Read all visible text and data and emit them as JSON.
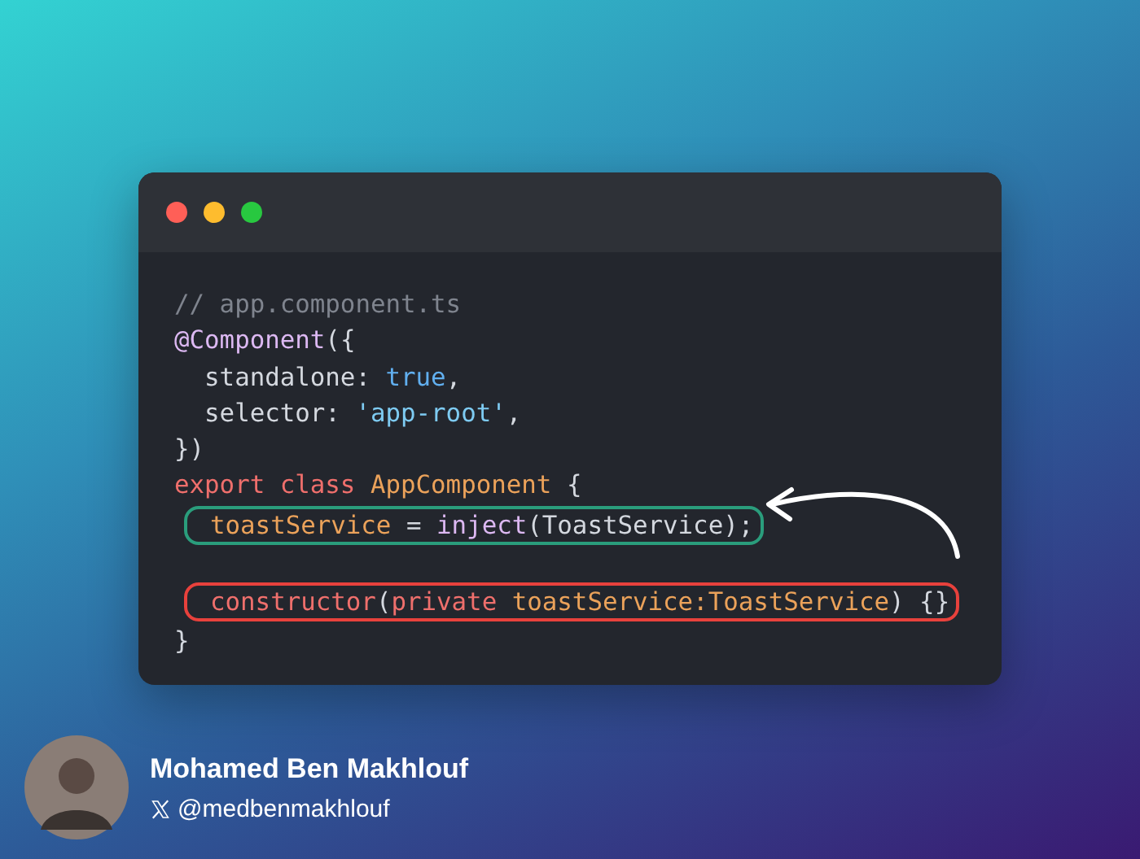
{
  "window": {
    "buttons": [
      {
        "color": "#ff5f57"
      },
      {
        "color": "#febc2e"
      },
      {
        "color": "#28c840"
      }
    ]
  },
  "code": {
    "lines": [
      {
        "tokens": [
          {
            "kind": "comment",
            "text": "// app.component.ts"
          }
        ]
      },
      {
        "tokens": [
          {
            "kind": "decorator",
            "text": "@Component"
          },
          {
            "kind": "plain",
            "text": "({"
          }
        ]
      },
      {
        "tokens": [
          {
            "kind": "plain",
            "text": "  standalone: "
          },
          {
            "kind": "literal",
            "text": "true"
          },
          {
            "kind": "plain",
            "text": ","
          }
        ]
      },
      {
        "tokens": [
          {
            "kind": "plain",
            "text": "  selector: "
          },
          {
            "kind": "string",
            "text": "'app-root'"
          },
          {
            "kind": "plain",
            "text": ","
          }
        ]
      },
      {
        "tokens": [
          {
            "kind": "plain",
            "text": "})"
          }
        ]
      },
      {
        "tokens": [
          {
            "kind": "keyword",
            "text": "export class "
          },
          {
            "kind": "name",
            "text": "AppComponent"
          },
          {
            "kind": "plain",
            "text": " {"
          }
        ]
      },
      {
        "color": "#2a9d7c",
        "tokens": [
          {
            "kind": "name",
            "text": "toastService"
          },
          {
            "kind": "plain",
            "text": " = "
          },
          {
            "kind": "decorator",
            "text": "inject"
          },
          {
            "kind": "plain",
            "text": "(ToastService);"
          }
        ]
      },
      {
        "color": "#e8413c",
        "tokens": [
          {
            "kind": "keyword",
            "text": "constructor"
          },
          {
            "kind": "plain",
            "text": "("
          },
          {
            "kind": "keyword",
            "text": "private "
          },
          {
            "kind": "name",
            "text": "toastService:ToastService"
          },
          {
            "kind": "plain",
            "text": ") {}"
          }
        ]
      },
      {
        "tokens": [
          {
            "kind": "plain",
            "text": "}"
          }
        ]
      }
    ]
  },
  "author": {
    "name": "Mohamed Ben Makhlouf",
    "handle": "@medbenmakhlouf"
  }
}
